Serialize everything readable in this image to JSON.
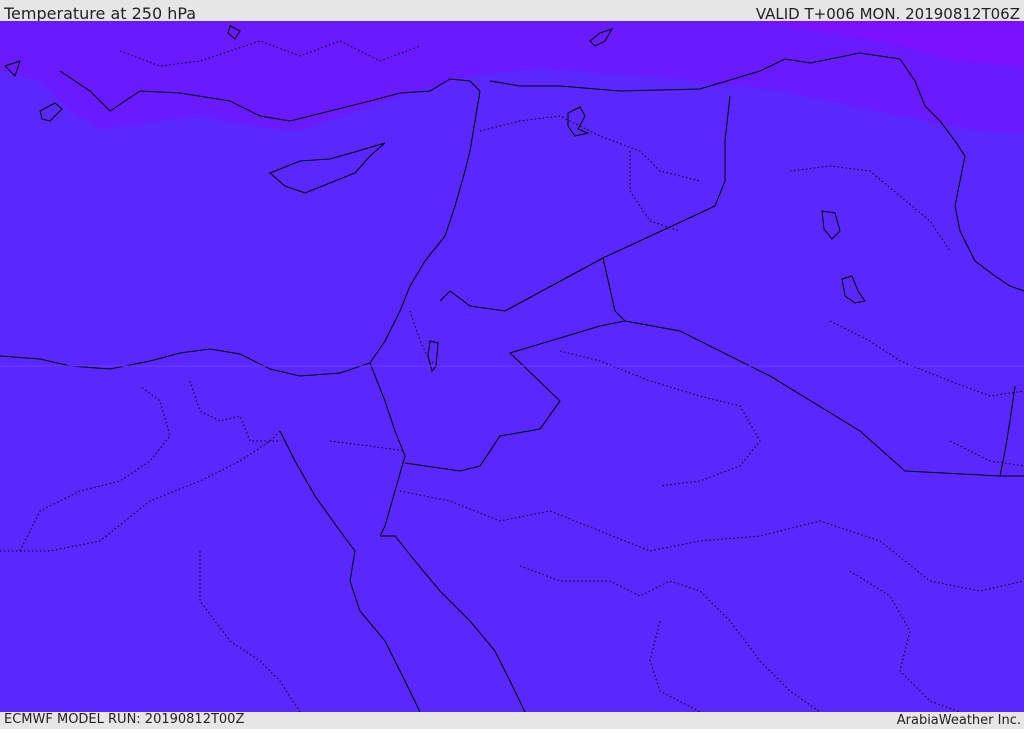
{
  "header": {
    "title": "Temperature at 250 hPa",
    "valid": "VALID T+006 MON. 20190812T06Z"
  },
  "footer": {
    "model_run": "ECMWF MODEL RUN: 20190812T00Z",
    "credit": "ArabiaWeather Inc."
  },
  "colors": {
    "main_fill": "#5a28ff",
    "cold_band_mid": "#6a1aff",
    "cold_band_deep": "#7a10ff",
    "coastline": "#000000",
    "bar_background": "#e6e6e6"
  }
}
